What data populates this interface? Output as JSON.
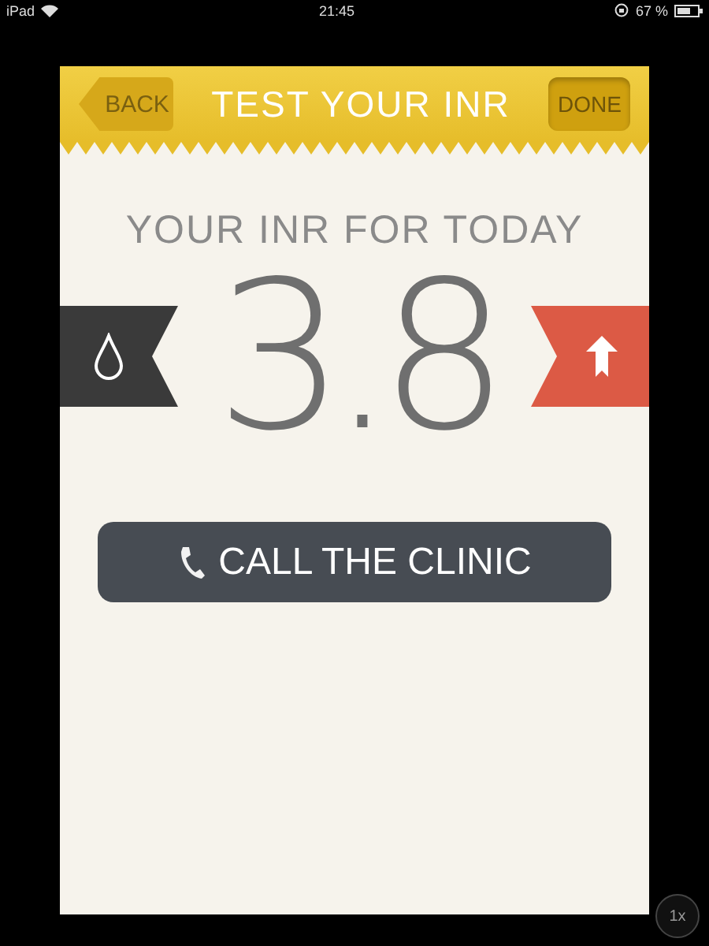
{
  "status_bar": {
    "device": "iPad",
    "time": "21:45",
    "battery": "67 %"
  },
  "header": {
    "back": "BACK",
    "title": "TEST YOUR INR",
    "done": "DONE"
  },
  "result": {
    "caption": "YOUR INR FOR TODAY",
    "value": "3.8",
    "rising": true
  },
  "call_button": {
    "label": "CALL THE CLINIC"
  },
  "zoom_badge": "1x"
}
